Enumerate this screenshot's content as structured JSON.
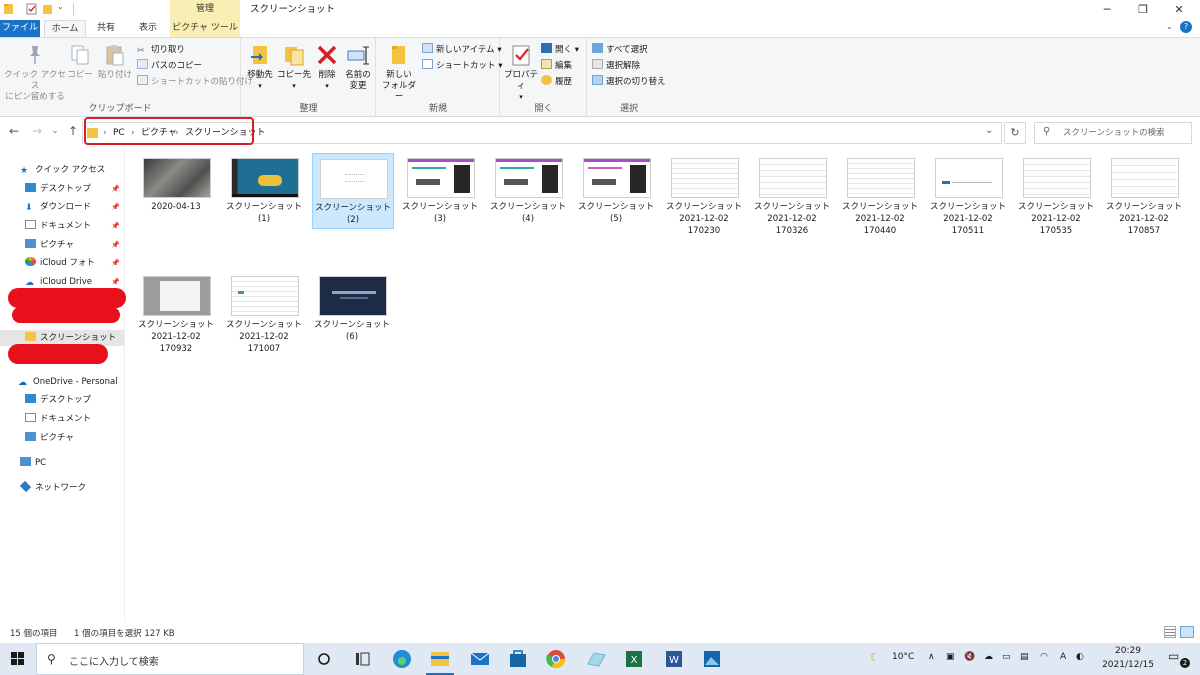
{
  "window": {
    "title": "スクリーンショット",
    "context_group": "管理",
    "controls": {
      "minimize": "─",
      "maximize": "❐",
      "close": "✕"
    },
    "help": "?"
  },
  "tabs": {
    "file": "ファイル",
    "home": "ホーム",
    "share": "共有",
    "view": "表示",
    "picture_tools": "ピクチャ ツール"
  },
  "ribbon": {
    "clipboard": {
      "label": "クリップボード",
      "pin_line1": "クイック アクセス",
      "pin_line2": "にピン留めする",
      "copy": "コピー",
      "paste": "貼り付け",
      "cut": "切り取り",
      "copy_path": "パスのコピー",
      "paste_shortcut": "ショートカットの貼り付け"
    },
    "organize": {
      "label": "整理",
      "move_to": "移動先",
      "copy_to": "コピー先",
      "delete": "削除",
      "rename_line1": "名前の",
      "rename_line2": "変更"
    },
    "new": {
      "label": "新規",
      "new_folder_line1": "新しい",
      "new_folder_line2": "フォルダー",
      "new_item": "新しいアイテム ▾",
      "easy_access": "ショートカット ▾"
    },
    "open": {
      "label": "開く",
      "properties": "プロパティ",
      "open": "開く ▾",
      "edit": "編集",
      "history": "履歴"
    },
    "select": {
      "label": "選択",
      "select_all": "すべて選択",
      "select_none": "選択解除",
      "invert": "選択の切り替え"
    }
  },
  "address": {
    "back": "←",
    "forward": "→",
    "recent": "⌄",
    "up": "↑",
    "crumbs": [
      "PC",
      "ピクチャ",
      "スクリーンショット"
    ],
    "separator": "›",
    "dropdown": "⌄",
    "refresh": "↻",
    "search_placeholder": "スクリーンショットの検索"
  },
  "nav": {
    "quick_access": "クイック アクセス",
    "desktop": "デスクトップ",
    "downloads": "ダウンロード",
    "documents": "ドキュメント",
    "pictures": "ピクチャ",
    "icloud_photos": "iCloud フォト",
    "icloud_drive": "iCloud Drive",
    "screenshots": "スクリーンショット",
    "onedrive": "OneDrive - Personal",
    "od_desktop": "デスクトップ",
    "od_documents": "ドキュメント",
    "od_pictures": "ピクチャ",
    "pc": "PC",
    "network": "ネットワーク"
  },
  "files": [
    {
      "line1": "2020-04-13",
      "line2": "",
      "line3": "",
      "thumb": "photo"
    },
    {
      "line1": "スクリーンショット",
      "line2": "(1)",
      "line3": "",
      "thumb": "desktop-car"
    },
    {
      "line1": "スクリーンショット",
      "line2": "(2)",
      "line3": "",
      "thumb": "white",
      "selected": true
    },
    {
      "line1": "スクリーンショット",
      "line2": "(3)",
      "line3": "",
      "thumb": "web-dark"
    },
    {
      "line1": "スクリーンショット",
      "line2": "(4)",
      "line3": "",
      "thumb": "web-dark"
    },
    {
      "line1": "スクリーンショット",
      "line2": "(5)",
      "line3": "",
      "thumb": "web-dark"
    },
    {
      "line1": "スクリーンショット",
      "line2": "2021-12-02",
      "line3": "170230",
      "thumb": "doc"
    },
    {
      "line1": "スクリーンショット",
      "line2": "2021-12-02",
      "line3": "170326",
      "thumb": "doc"
    },
    {
      "line1": "スクリーンショット",
      "line2": "2021-12-02",
      "line3": "170440",
      "thumb": "doc"
    },
    {
      "line1": "スクリーンショット",
      "line2": "2021-12-02",
      "line3": "170511",
      "thumb": "doc-blue"
    },
    {
      "line1": "スクリーンショット",
      "line2": "2021-12-02",
      "line3": "170535",
      "thumb": "doc"
    },
    {
      "line1": "スクリーンショット",
      "line2": "2021-12-02",
      "line3": "170857",
      "thumb": "doc"
    },
    {
      "line1": "スクリーンショット",
      "line2": "2021-12-02",
      "line3": "170932",
      "thumb": "gray-dialog"
    },
    {
      "line1": "スクリーンショット",
      "line2": "2021-12-02",
      "line3": "171007",
      "thumb": "doc-green"
    },
    {
      "line1": "スクリーンショット",
      "line2": "(6)",
      "line3": "",
      "thumb": "navy"
    }
  ],
  "status": {
    "count": "15 個の項目",
    "selected": "1 個の項目を選択  127 KB"
  },
  "taskbar": {
    "search_placeholder": "ここに入力して検索",
    "weather": "10°C",
    "time": "20:29",
    "date": "2021/12/15",
    "notifications": "2",
    "tray_chevron": "∧",
    "ime": "A"
  }
}
